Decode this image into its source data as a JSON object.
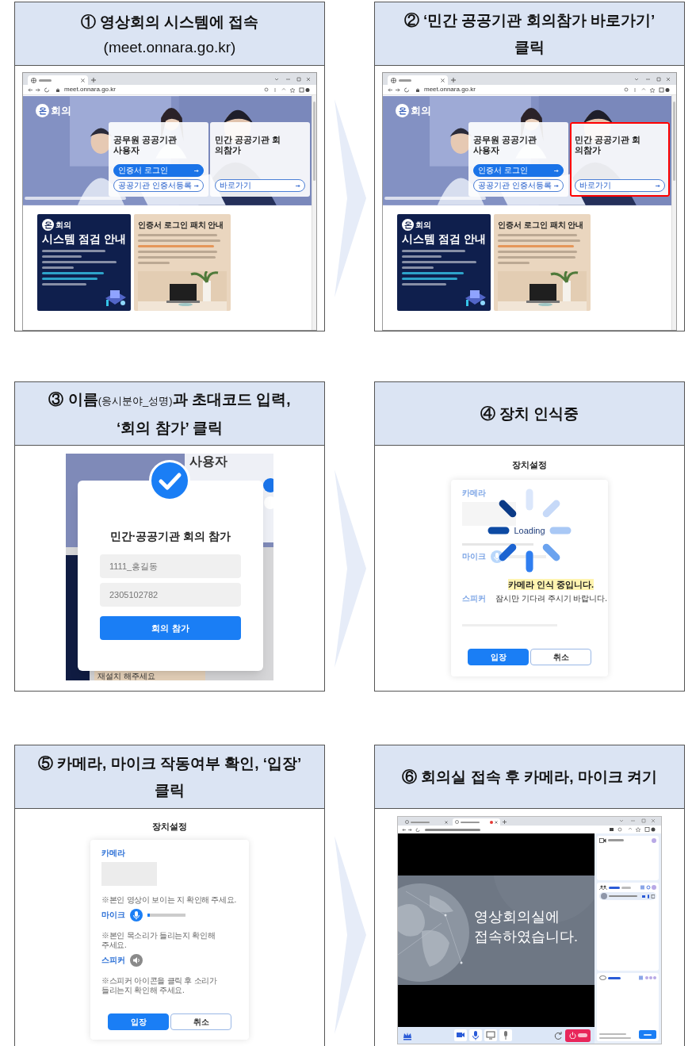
{
  "steps": [
    {
      "title": [
        {
          "text": "① 영상회의 시스템에 접속",
          "small": false
        }
      ],
      "subtitle": "(meet.onnara.go.kr)",
      "screen": {
        "kind": "portal",
        "url": "meet.onnara.go.kr",
        "logo_mark": "온",
        "logo_text": "회의",
        "cards": [
          {
            "title": "공무원 공공기관 사용자",
            "highlighted": false,
            "buttons": [
              {
                "label": "인증서 로그인",
                "kind": "primary"
              },
              {
                "label": "공공기관 인증서등록",
                "kind": "outline"
              }
            ]
          },
          {
            "title": "민간 공공기관 회의참가",
            "highlighted": false,
            "buttons": [
              {
                "label": "바로가기",
                "kind": "outline"
              }
            ]
          }
        ],
        "notices": [
          {
            "kind": "dark",
            "logo_mark": "온",
            "logo_text": "회의",
            "title": "시스템 점검 안내"
          },
          {
            "kind": "light",
            "title": "인증서 로그인 패치 안내"
          }
        ]
      }
    },
    {
      "title": [
        {
          "text": "② ‘민간 공공기관 회의참가 바로가기’ 클릭",
          "small": false
        }
      ],
      "screen": {
        "kind": "portal",
        "url": "meet.onnara.go.kr",
        "logo_mark": "온",
        "logo_text": "회의",
        "cards": [
          {
            "title": "공무원 공공기관 사용자",
            "highlighted": false,
            "buttons": [
              {
                "label": "인증서 로그인",
                "kind": "primary"
              },
              {
                "label": "공공기관 인증서등록",
                "kind": "outline"
              }
            ]
          },
          {
            "title": "민간 공공기관 회의참가",
            "highlighted": true,
            "buttons": [
              {
                "label": "바로가기",
                "kind": "outline"
              }
            ]
          }
        ],
        "notices": [
          {
            "kind": "dark",
            "logo_mark": "온",
            "logo_text": "회의",
            "title": "시스템 점검 안내"
          },
          {
            "kind": "light",
            "title": "인증서 로그인 패치 안내"
          }
        ]
      }
    },
    {
      "title": [
        {
          "text": "③ 이름",
          "small": false
        },
        {
          "text": "(응시분야_성명)",
          "small": true
        },
        {
          "text": "과 초대코드 입력, ‘회의 참가’ 클릭",
          "small": false
        }
      ],
      "screen": {
        "kind": "join_dialog",
        "background_texts": [
          "사용자",
          "재설치 해주세요"
        ],
        "title": "민간·공공기관 회의 참가",
        "fields": [
          {
            "value": "1111_홍길동"
          },
          {
            "value": "2305102782"
          }
        ],
        "button": "회의 참가"
      }
    },
    {
      "title": [
        {
          "text": "④ 장치 인식중",
          "small": false
        }
      ],
      "screen": {
        "kind": "device_loading",
        "heading": "장치설정",
        "faded_labels": [
          "카메라",
          "마이크",
          "스피커"
        ],
        "spinner_label": "Loading",
        "message": "카메라 인식 중입니다.",
        "submessage": "잠시만 기다려 주시기 바랍니다.",
        "buttons": [
          {
            "label": "입장",
            "kind": "primary"
          },
          {
            "label": "취소",
            "kind": "outline"
          }
        ]
      }
    },
    {
      "title": [
        {
          "text": "⑤ 카메라, 마이크 작동여부 확인, ‘입장’ 클릭",
          "small": false
        }
      ],
      "screen": {
        "kind": "device_settings",
        "heading": "장치설정",
        "sections": [
          {
            "kind": "label",
            "text": "카메라"
          },
          {
            "kind": "camera_preview"
          },
          {
            "kind": "hint",
            "text": "※본인 영상이 보이는 지 확인해 주세요."
          },
          {
            "kind": "mic",
            "label": "마이크",
            "level": 0.06
          },
          {
            "kind": "hint",
            "text": "※본인 목소리가 들리는지 확인해 주세요."
          },
          {
            "kind": "speaker",
            "label": "스피커"
          },
          {
            "kind": "hint",
            "text": "※스피커 아이콘을 클릭 후 소리가 들리는지 확인해 주세요."
          }
        ],
        "buttons": [
          {
            "label": "입장",
            "kind": "primary"
          },
          {
            "label": "취소",
            "kind": "outline"
          }
        ]
      }
    },
    {
      "title": [
        {
          "text": "⑥ 회의실 접속 후 카메라, 마이크 켜기",
          "small": false
        }
      ],
      "screen": {
        "kind": "meeting_room",
        "message": "영상회의실에 접속하였습니다."
      }
    }
  ]
}
